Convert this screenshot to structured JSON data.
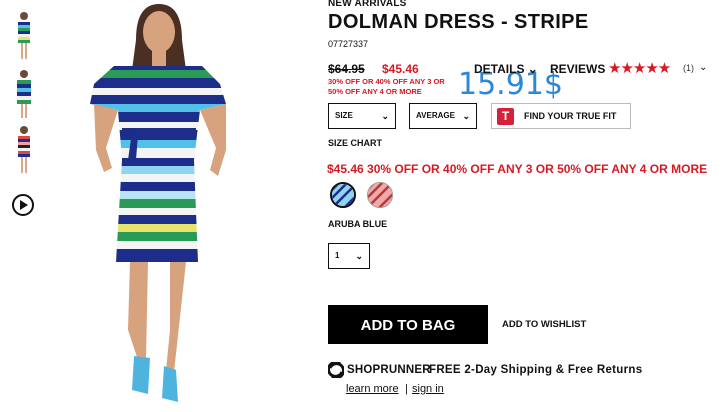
{
  "thumbnails": [
    {
      "name": "thumbnail-front-view"
    },
    {
      "name": "thumbnail-detail-view"
    },
    {
      "name": "thumbnail-alt-color-view"
    }
  ],
  "product": {
    "eyebrow": "NEW ARRIVALS",
    "title": "DOLMAN DRESS - STRIPE",
    "sku": "07727337",
    "original_price": "$64.95",
    "sale_price": "$45.46",
    "promo_small": "30% OFF OR 40% OFF ANY 3 OR 50% OFF ANY 4 OR MORE",
    "overlay_price": "15.91$",
    "promo_big": "$45.46 30% OFF OR 40% OFF ANY 3 OR 50% OFF ANY 4 OR MORE",
    "color_name": "ARUBA BLUE"
  },
  "tabs": {
    "details": "DETAILS",
    "reviews": "REVIEWS",
    "stars": "★★★★★",
    "review_count": "(1)"
  },
  "selectors": {
    "size": "SIZE",
    "length": "AVERAGE",
    "quantity": "1",
    "chevron": "⌄"
  },
  "fit": {
    "logo": "T",
    "label": "FIND YOUR TRUE FIT"
  },
  "links": {
    "size_chart": "SIZE CHART",
    "wishlist": "ADD TO WISHLIST"
  },
  "actions": {
    "add_to_bag": "ADD TO BAG"
  },
  "shoprunner": {
    "brand": "SHOPRUNNER",
    "text": "FREE 2-Day Shipping & Free Returns",
    "learn_more": "learn more",
    "separator": "|",
    "sign_in": "sign in"
  },
  "colors": {
    "sale_red": "#d51a24",
    "overlay_blue": "#2b87d8",
    "button_black": "#000000"
  }
}
